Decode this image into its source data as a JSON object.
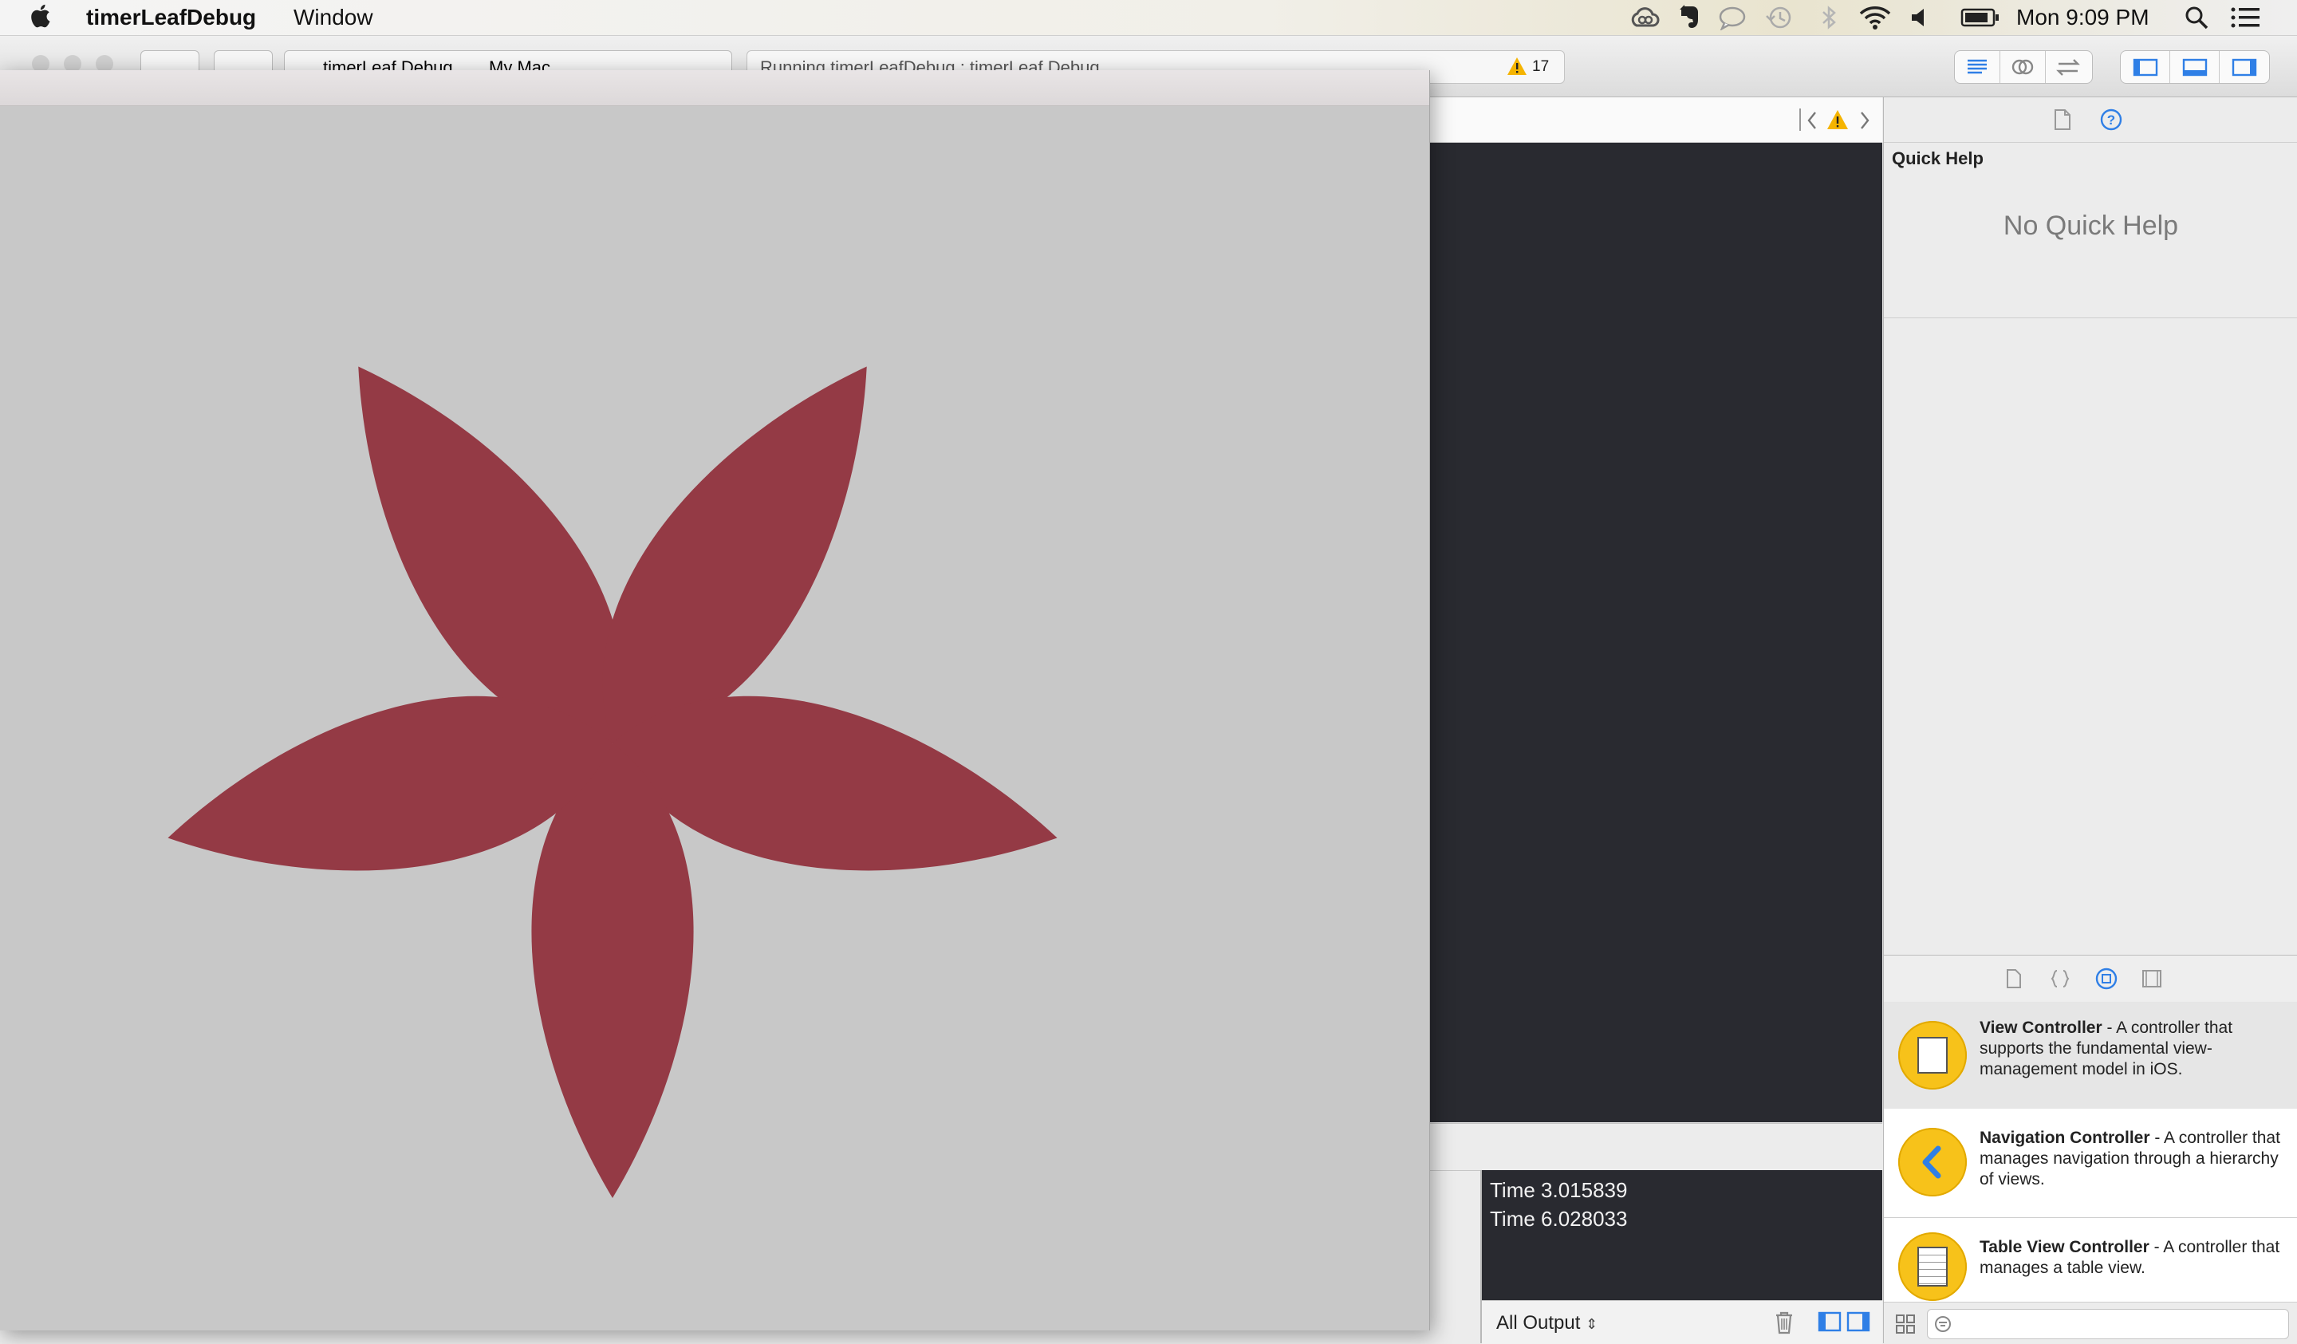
{
  "menubar": {
    "app_name": "timerLeafDebug",
    "menu_window": "Window",
    "clock": "Mon 9:09 PM"
  },
  "toolbar": {
    "scheme": "timerLeaf Debug",
    "destination": "My Mac",
    "activity_status": "Running timerLeafDebug : timerLeaf Debug",
    "warning_count": "17"
  },
  "utility": {
    "quick_help_title": "Quick Help",
    "no_quick_help": "No Quick Help",
    "library_items": [
      {
        "name": "View Controller",
        "desc": " - A controller that supports the fundamental view-management model in iOS."
      },
      {
        "name": "Navigation Controller",
        "desc": " - A controller that manages navigation through a hierarchy of views."
      },
      {
        "name": "Table View Controller",
        "desc": " - A controller that manages a table view."
      }
    ]
  },
  "console": {
    "lines": [
      "Time 3.015839",
      "Time 6.028033"
    ],
    "output_filter": "All Output"
  },
  "app_window": {
    "background": "#c8c8c8",
    "leaf_color": "#943a45"
  }
}
